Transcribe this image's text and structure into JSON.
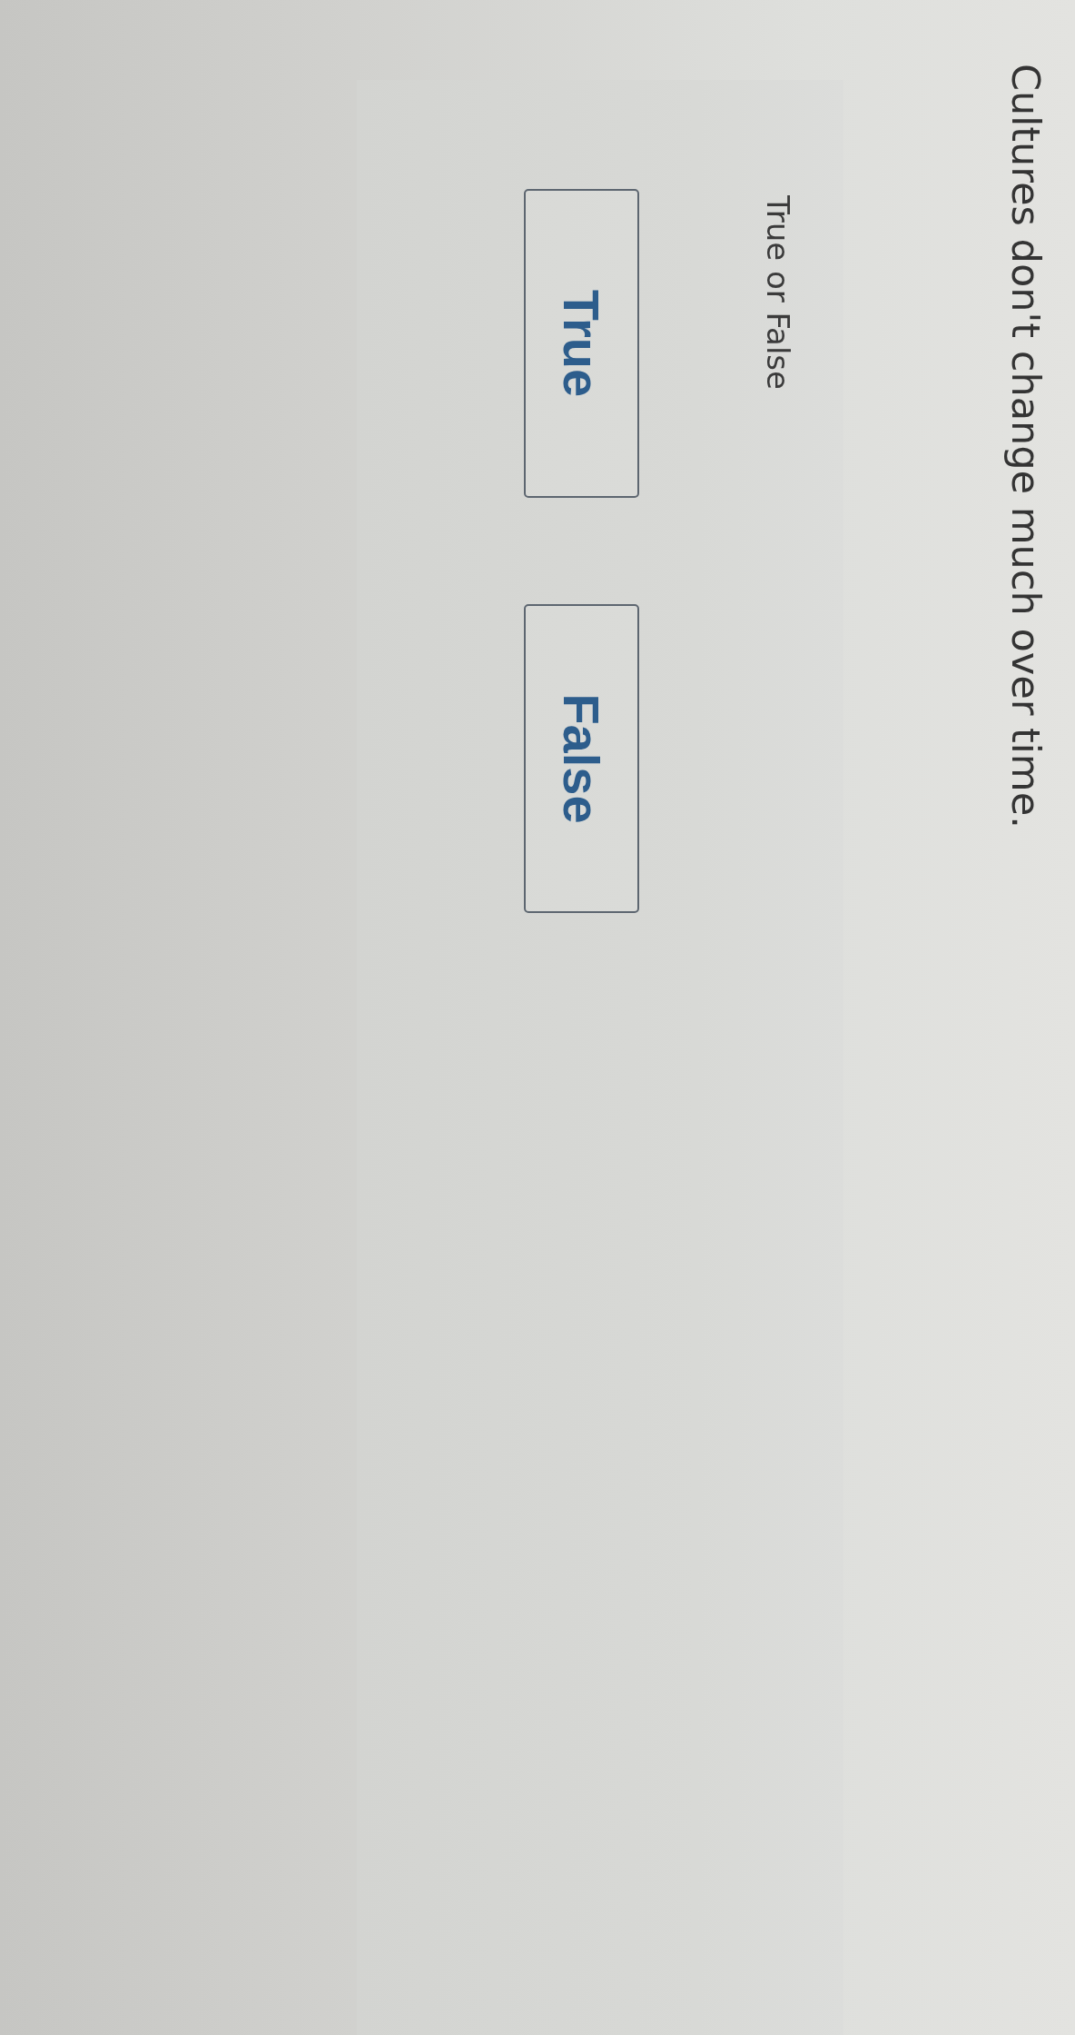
{
  "question": {
    "text": "Cultures don't change much over time."
  },
  "answer_panel": {
    "label": "True or False",
    "options": [
      {
        "label": "True",
        "selected": false
      },
      {
        "label": "False",
        "selected": false
      }
    ]
  }
}
